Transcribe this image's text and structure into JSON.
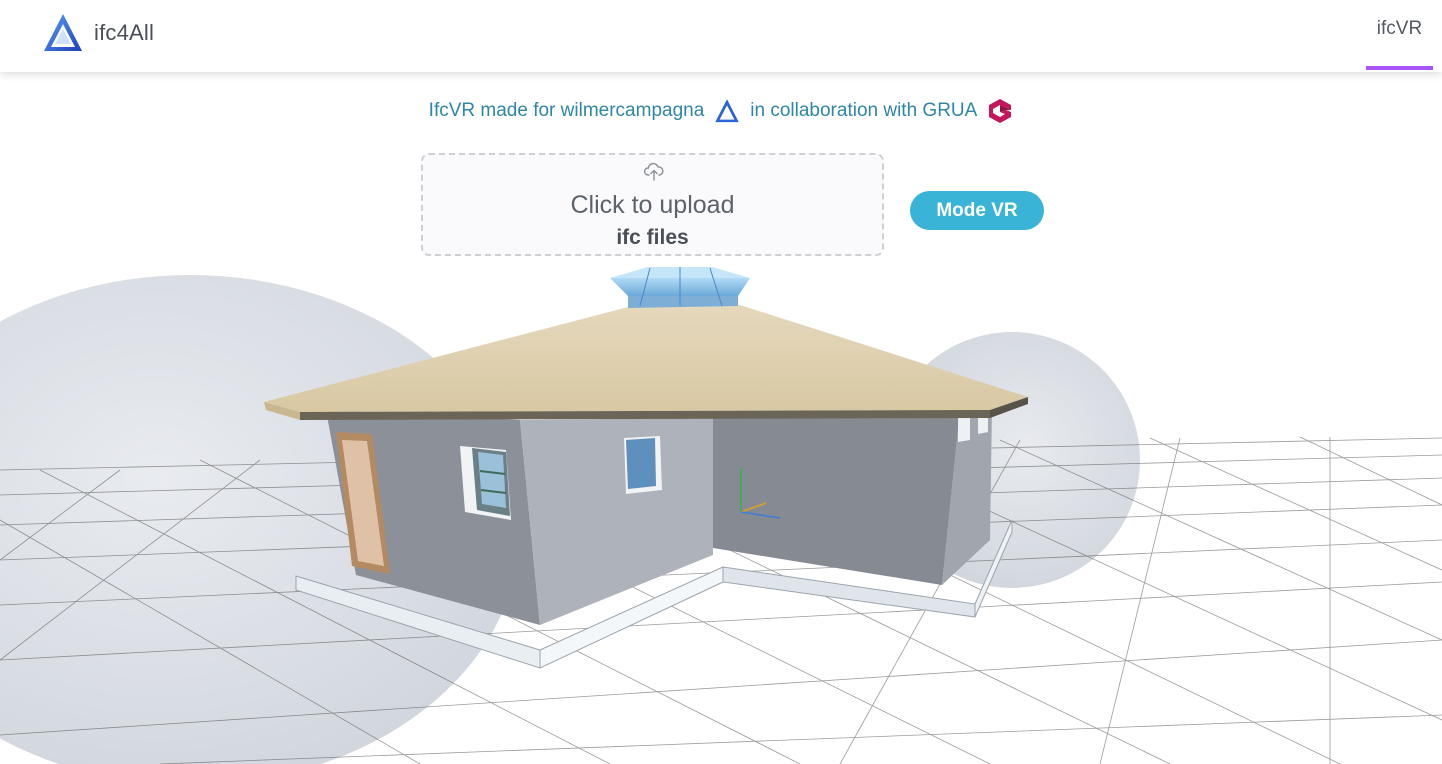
{
  "nav": {
    "brand": "ifc4All",
    "tab": "ifcVR"
  },
  "credits": {
    "prefix": "IfcVR made for wilmercampagna",
    "middle": "in collaboration with GRUA"
  },
  "upload": {
    "title": "Click to upload",
    "subtitle": "ifc files"
  },
  "mode_button": "Mode VR",
  "colors": {
    "accent": "#a855f7",
    "button": "#3ab4d6",
    "link_text": "#2f86a6",
    "brand_logo": "#2b63d9",
    "grua_logo": "#c2185b"
  }
}
